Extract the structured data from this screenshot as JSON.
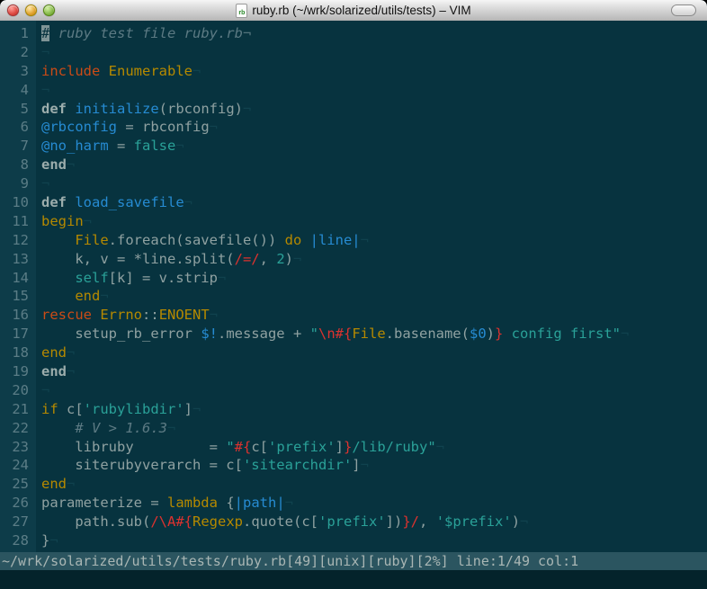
{
  "window": {
    "title": "ruby.rb (~/wrk/solarized/utils/tests) – VIM",
    "doc_icon_label": "rb"
  },
  "colors": {
    "bg": "#07333f",
    "gutterBg": "#0d3c49",
    "lineNr": "#5b7d86",
    "base": "#8fa1a1",
    "comment": "#5c7a83",
    "yellow": "#b58900",
    "orange": "#cb4b16",
    "red": "#dc322f",
    "blue": "#268bd2",
    "cyan": "#2aa198",
    "defb": "#9cadac",
    "cursorBg": "#7f9496",
    "cursorFg": "#06323e",
    "eolComment": "#54737c",
    "eolDim": "#10424e",
    "statusBg": "#2b5560",
    "statusFg": "#a9b6b4",
    "cmdBg": "#04232b",
    "trafficRed": "#dd4840",
    "trafficYellow": "#e0a12d",
    "trafficGreen": "#85b848"
  },
  "editor": {
    "lines": [
      {
        "n": 1,
        "segs": [
          [
            "#",
            "cursor"
          ],
          [
            " ruby test file ruby.rb",
            "comment"
          ],
          [
            "¬",
            "eolc"
          ]
        ]
      },
      {
        "n": 2,
        "segs": [
          [
            "¬",
            "eold"
          ]
        ]
      },
      {
        "n": 3,
        "segs": [
          [
            "include",
            "orange"
          ],
          [
            " ",
            "base"
          ],
          [
            "Enumerable",
            "yellow"
          ],
          [
            "¬",
            "eold"
          ]
        ]
      },
      {
        "n": 4,
        "segs": [
          [
            "¬",
            "eold"
          ]
        ]
      },
      {
        "n": 5,
        "segs": [
          [
            "def",
            "defb"
          ],
          [
            " ",
            "base"
          ],
          [
            "initialize",
            "blue"
          ],
          [
            "(rbconfig)",
            "base"
          ],
          [
            "¬",
            "eold"
          ]
        ]
      },
      {
        "n": 6,
        "segs": [
          [
            "@rbconfig",
            "blue"
          ],
          [
            " = rbconfig",
            "base"
          ],
          [
            "¬",
            "eold"
          ]
        ]
      },
      {
        "n": 7,
        "segs": [
          [
            "@no_harm",
            "blue"
          ],
          [
            " = ",
            "base"
          ],
          [
            "false",
            "cyan"
          ],
          [
            "¬",
            "eold"
          ]
        ]
      },
      {
        "n": 8,
        "segs": [
          [
            "end",
            "defb"
          ],
          [
            "¬",
            "eold"
          ]
        ]
      },
      {
        "n": 9,
        "segs": [
          [
            "¬",
            "eold"
          ]
        ]
      },
      {
        "n": 10,
        "segs": [
          [
            "def",
            "defb"
          ],
          [
            " ",
            "base"
          ],
          [
            "load_savefile",
            "blue"
          ],
          [
            "¬",
            "eold"
          ]
        ]
      },
      {
        "n": 11,
        "segs": [
          [
            "begin",
            "yellow"
          ],
          [
            "¬",
            "eold"
          ]
        ]
      },
      {
        "n": 12,
        "segs": [
          [
            "    ",
            "base"
          ],
          [
            "File",
            "yellow"
          ],
          [
            ".foreach(savefile()) ",
            "base"
          ],
          [
            "do",
            "yellow"
          ],
          [
            " ",
            "base"
          ],
          [
            "|line|",
            "blue"
          ],
          [
            "¬",
            "eold"
          ]
        ]
      },
      {
        "n": 13,
        "segs": [
          [
            "    k, v = *line.split(",
            "base"
          ],
          [
            "/=/",
            "red"
          ],
          [
            ", ",
            "base"
          ],
          [
            "2",
            "cyan"
          ],
          [
            ")",
            "base"
          ],
          [
            "¬",
            "eold"
          ]
        ]
      },
      {
        "n": 14,
        "segs": [
          [
            "    ",
            "base"
          ],
          [
            "self",
            "cyan"
          ],
          [
            "[k] = v.strip",
            "base"
          ],
          [
            "¬",
            "eold"
          ]
        ]
      },
      {
        "n": 15,
        "segs": [
          [
            "    ",
            "base"
          ],
          [
            "end",
            "yellow"
          ],
          [
            "¬",
            "eold"
          ]
        ]
      },
      {
        "n": 16,
        "segs": [
          [
            "rescue",
            "orange"
          ],
          [
            " ",
            "base"
          ],
          [
            "Errno",
            "yellow"
          ],
          [
            "::",
            "base"
          ],
          [
            "ENOENT",
            "yellow"
          ],
          [
            "¬",
            "eold"
          ]
        ]
      },
      {
        "n": 17,
        "segs": [
          [
            "    setup_rb_error ",
            "base"
          ],
          [
            "$!",
            "blue"
          ],
          [
            ".message + ",
            "base"
          ],
          [
            "\"",
            "cyan"
          ],
          [
            "\\n",
            "red"
          ],
          [
            "#{",
            "red"
          ],
          [
            "File",
            "yellow"
          ],
          [
            ".basename(",
            "base"
          ],
          [
            "$0",
            "blue"
          ],
          [
            ")",
            "base"
          ],
          [
            "}",
            "red"
          ],
          [
            " config first",
            "cyan"
          ],
          [
            "\"",
            "cyan"
          ],
          [
            "¬",
            "eold"
          ]
        ]
      },
      {
        "n": 18,
        "segs": [
          [
            "end",
            "yellow"
          ],
          [
            "¬",
            "eold"
          ]
        ]
      },
      {
        "n": 19,
        "segs": [
          [
            "end",
            "defb"
          ],
          [
            "¬",
            "eold"
          ]
        ]
      },
      {
        "n": 20,
        "segs": [
          [
            "¬",
            "eold"
          ]
        ]
      },
      {
        "n": 21,
        "segs": [
          [
            "if",
            "yellow"
          ],
          [
            " c[",
            "base"
          ],
          [
            "'rubylibdir'",
            "cyan"
          ],
          [
            "]",
            "base"
          ],
          [
            "¬",
            "eold"
          ]
        ]
      },
      {
        "n": 22,
        "segs": [
          [
            "    ",
            "base"
          ],
          [
            "# V > 1.6.3",
            "comment"
          ],
          [
            "¬",
            "eold"
          ]
        ]
      },
      {
        "n": 23,
        "segs": [
          [
            "    libruby         = ",
            "base"
          ],
          [
            "\"",
            "cyan"
          ],
          [
            "#{",
            "red"
          ],
          [
            "c[",
            "base"
          ],
          [
            "'prefix'",
            "cyan"
          ],
          [
            "]",
            "base"
          ],
          [
            "}",
            "red"
          ],
          [
            "/lib/ruby",
            "cyan"
          ],
          [
            "\"",
            "cyan"
          ],
          [
            "¬",
            "eold"
          ]
        ]
      },
      {
        "n": 24,
        "segs": [
          [
            "    siterubyverarch = c[",
            "base"
          ],
          [
            "'sitearchdir'",
            "cyan"
          ],
          [
            "]",
            "base"
          ],
          [
            "¬",
            "eold"
          ]
        ]
      },
      {
        "n": 25,
        "segs": [
          [
            "end",
            "yellow"
          ],
          [
            "¬",
            "eold"
          ]
        ]
      },
      {
        "n": 26,
        "segs": [
          [
            "parameterize = ",
            "base"
          ],
          [
            "lambda",
            "yellow"
          ],
          [
            " {",
            "base"
          ],
          [
            "|path|",
            "blue"
          ],
          [
            "¬",
            "eold"
          ]
        ]
      },
      {
        "n": 27,
        "segs": [
          [
            "    path.sub(",
            "base"
          ],
          [
            "/\\A",
            "red"
          ],
          [
            "#{",
            "red"
          ],
          [
            "Regexp",
            "yellow"
          ],
          [
            ".quote(c[",
            "base"
          ],
          [
            "'prefix'",
            "cyan"
          ],
          [
            "])",
            "base"
          ],
          [
            "}",
            "red"
          ],
          [
            "/",
            "red"
          ],
          [
            ", ",
            "base"
          ],
          [
            "'$prefix'",
            "cyan"
          ],
          [
            ")",
            "base"
          ],
          [
            "¬",
            "eold"
          ]
        ]
      },
      {
        "n": 28,
        "segs": [
          [
            "}",
            "base"
          ],
          [
            "¬",
            "eold"
          ]
        ]
      }
    ]
  },
  "status_bar": {
    "text": "~/wrk/solarized/utils/tests/ruby.rb[49][unix][ruby][2%] line:1/49 col:1"
  }
}
